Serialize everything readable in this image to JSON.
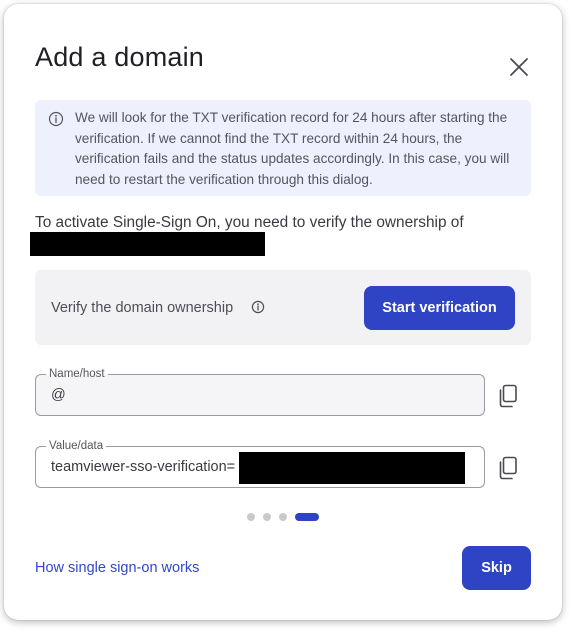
{
  "dialog": {
    "title": "Add a domain",
    "close_icon": "close-icon"
  },
  "info": {
    "icon": "info-circle-icon",
    "text": "We will look for the TXT verification record for 24 hours after starting the verification. If we cannot find the TXT record within 24 hours, the verification fails and the status updates accordingly. In this case, you will need to restart the verification through this dialog."
  },
  "intro": {
    "text": "To activate Single-Sign On, you need to verify the ownership of"
  },
  "verify": {
    "label": "Verify the domain ownership",
    "info_icon": "info-circle-icon",
    "button_label": "Start verification"
  },
  "fields": {
    "host": {
      "label": "Name/host",
      "value": "@",
      "copy_icon": "copy-icon"
    },
    "value": {
      "label": "Value/data",
      "value": "teamviewer-sso-verification=",
      "copy_icon": "copy-icon"
    }
  },
  "stepper": {
    "total": 4,
    "current": 4
  },
  "footer": {
    "help_link": "How single sign-on works",
    "skip_label": "Skip"
  },
  "colors": {
    "primary": "#2f44c5",
    "info_bg": "#eef0fd",
    "verify_bg": "#f2f2f5",
    "link": "#3148c6"
  }
}
